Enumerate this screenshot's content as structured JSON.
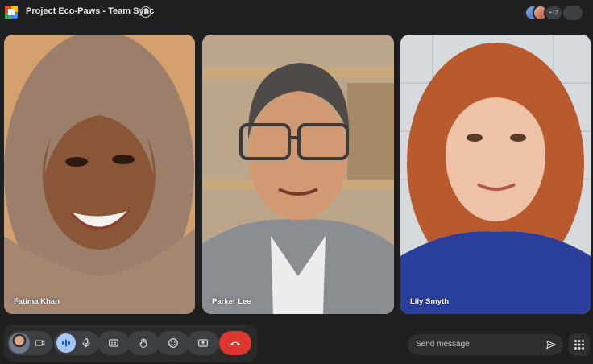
{
  "meeting": {
    "title": "Project Eco-Paws - Team Sync",
    "info_icon": "info-icon",
    "info_glyph": "i"
  },
  "people_panel": {
    "extra_count": "+17"
  },
  "participants": [
    {
      "name": "Fatima Khan"
    },
    {
      "name": "Parker Lee"
    },
    {
      "name": "Lily Smyth"
    }
  ],
  "controls": {
    "camera_icon": "videocam-icon",
    "mic_icon": "mic-icon",
    "captions_icon": "closed-captions-icon",
    "raise_hand_icon": "raise-hand-icon",
    "reactions_icon": "emoji-icon",
    "present_icon": "present-screen-icon",
    "end_call_icon": "call-end-icon"
  },
  "chat": {
    "placeholder": "Send message",
    "send_icon": "send-icon"
  },
  "apps_icon": "apps-grid-icon",
  "colors": {
    "background": "#1f1f1f",
    "control": "#3c4043",
    "end_call": "#dc362e",
    "active_audio": "#a8c7fa"
  }
}
